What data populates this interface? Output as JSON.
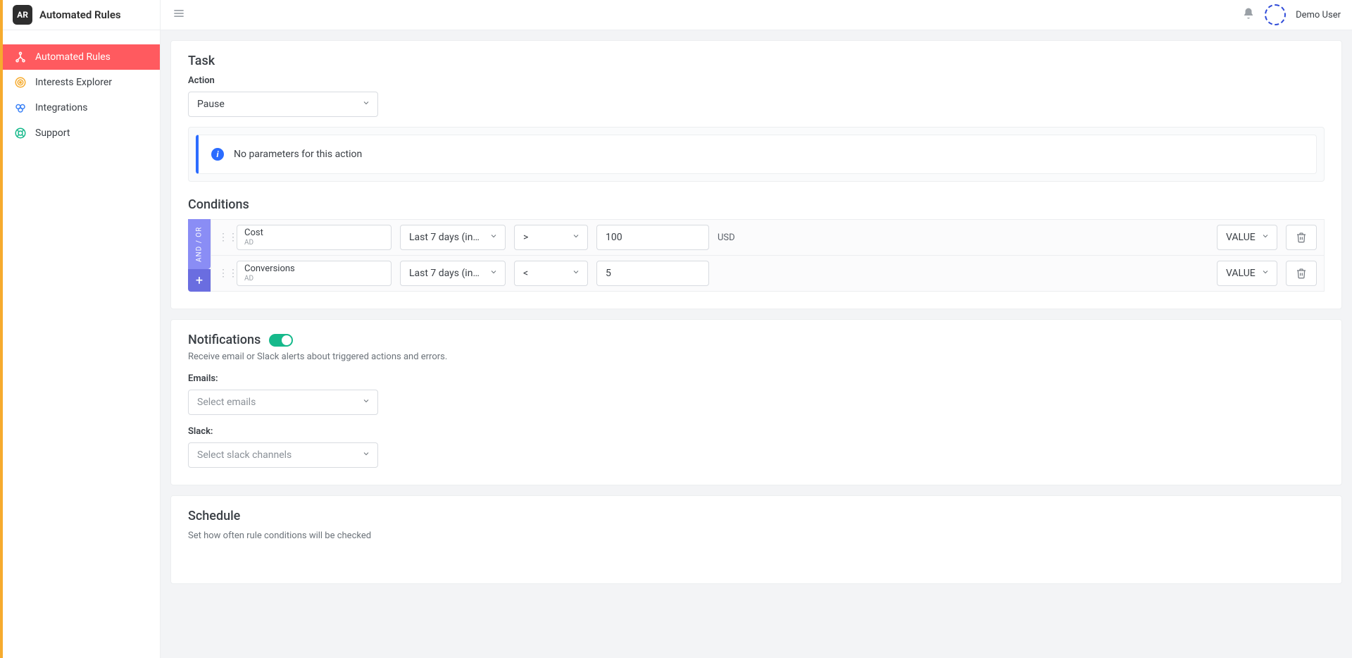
{
  "brand": {
    "badge": "AR",
    "name": "Automated Rules"
  },
  "sidebar": {
    "items": [
      {
        "label": "Automated Rules"
      },
      {
        "label": "Interests Explorer"
      },
      {
        "label": "Integrations"
      },
      {
        "label": "Support"
      }
    ]
  },
  "topbar": {
    "username": "Demo User"
  },
  "task": {
    "title": "Task",
    "action_label": "Action",
    "action_value": "Pause",
    "info_text": "No parameters for this action"
  },
  "conditions": {
    "title": "Conditions",
    "andor_label": "AND / OR",
    "add_label": "+",
    "rows": [
      {
        "metric": "Cost",
        "level": "AD",
        "timeframe": "Last 7 days (includin...",
        "operator": ">",
        "value": "100",
        "unit": "USD",
        "value_type": "VALUE"
      },
      {
        "metric": "Conversions",
        "level": "AD",
        "timeframe": "Last 7 days (includin...",
        "operator": "<",
        "value": "5",
        "unit": "",
        "value_type": "VALUE"
      }
    ]
  },
  "notifications": {
    "title": "Notifications",
    "description": "Receive email or Slack alerts about triggered actions and errors.",
    "emails_label": "Emails:",
    "emails_placeholder": "Select emails",
    "slack_label": "Slack:",
    "slack_placeholder": "Select slack channels"
  },
  "schedule": {
    "title": "Schedule",
    "description": "Set how often rule conditions will be checked"
  }
}
